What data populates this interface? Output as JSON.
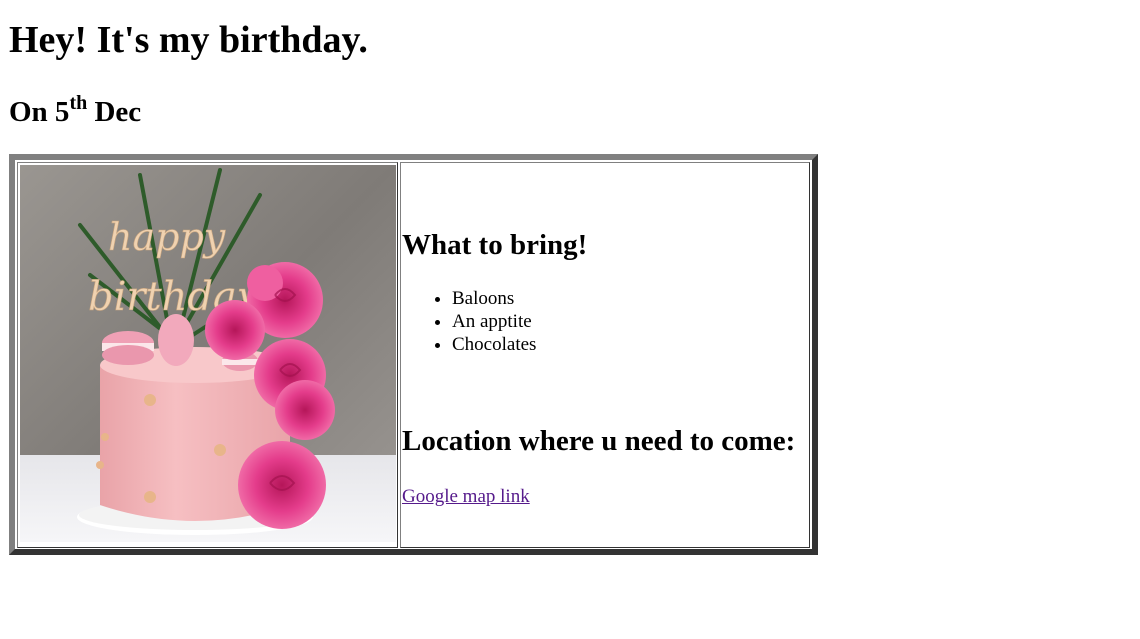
{
  "heading": "Hey! It's my birthday.",
  "date": {
    "prefix": "On 5",
    "suffix": "th",
    "rest": " Dec"
  },
  "image": {
    "description_text": "happy birthday",
    "topper_line1": "happy",
    "topper_line2": "birthday"
  },
  "info": {
    "bring_heading": "What to bring!",
    "items": [
      "Baloons",
      "An apptite",
      "Chocolates"
    ],
    "location_heading": "Location where u need to come:",
    "map_link": "Google map link"
  },
  "colors": {
    "link_visited": "#551a8b",
    "cake": "#f4b6bb",
    "rose": "#e03a8a",
    "wall": "#8f8c88"
  }
}
